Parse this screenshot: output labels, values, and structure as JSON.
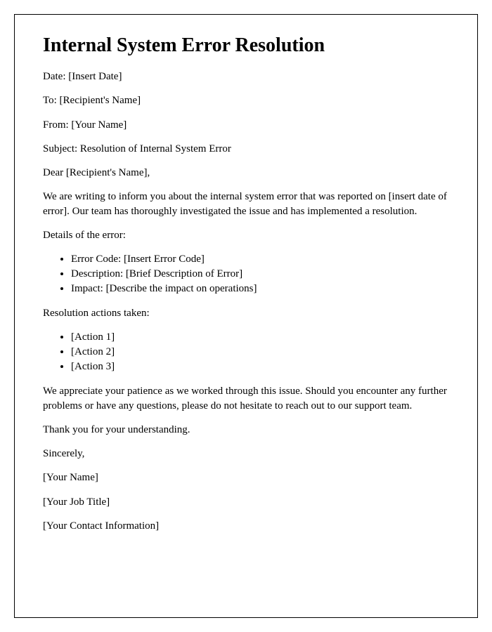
{
  "title": "Internal System Error Resolution",
  "date_line": "Date: [Insert Date]",
  "to_line": "To: [Recipient's Name]",
  "from_line": "From: [Your Name]",
  "subject_line": "Subject: Resolution of Internal System Error",
  "salutation": "Dear [Recipient's Name],",
  "intro_paragraph": "We are writing to inform you about the internal system error that was reported on [insert date of error]. Our team has thoroughly investigated the issue and has implemented a resolution.",
  "details_heading": "Details of the error:",
  "details": {
    "error_code": "Error Code: [Insert Error Code]",
    "description": "Description: [Brief Description of Error]",
    "impact": "Impact: [Describe the impact on operations]"
  },
  "resolution_heading": "Resolution actions taken:",
  "actions": {
    "a1": "[Action 1]",
    "a2": "[Action 2]",
    "a3": "[Action 3]"
  },
  "closing_paragraph": "We appreciate your patience as we worked through this issue. Should you encounter any further problems or have any questions, please do not hesitate to reach out to our support team.",
  "thanks": "Thank you for your understanding.",
  "signoff": "Sincerely,",
  "sender_name": "[Your Name]",
  "sender_title": "[Your Job Title]",
  "sender_contact": "[Your Contact Information]"
}
